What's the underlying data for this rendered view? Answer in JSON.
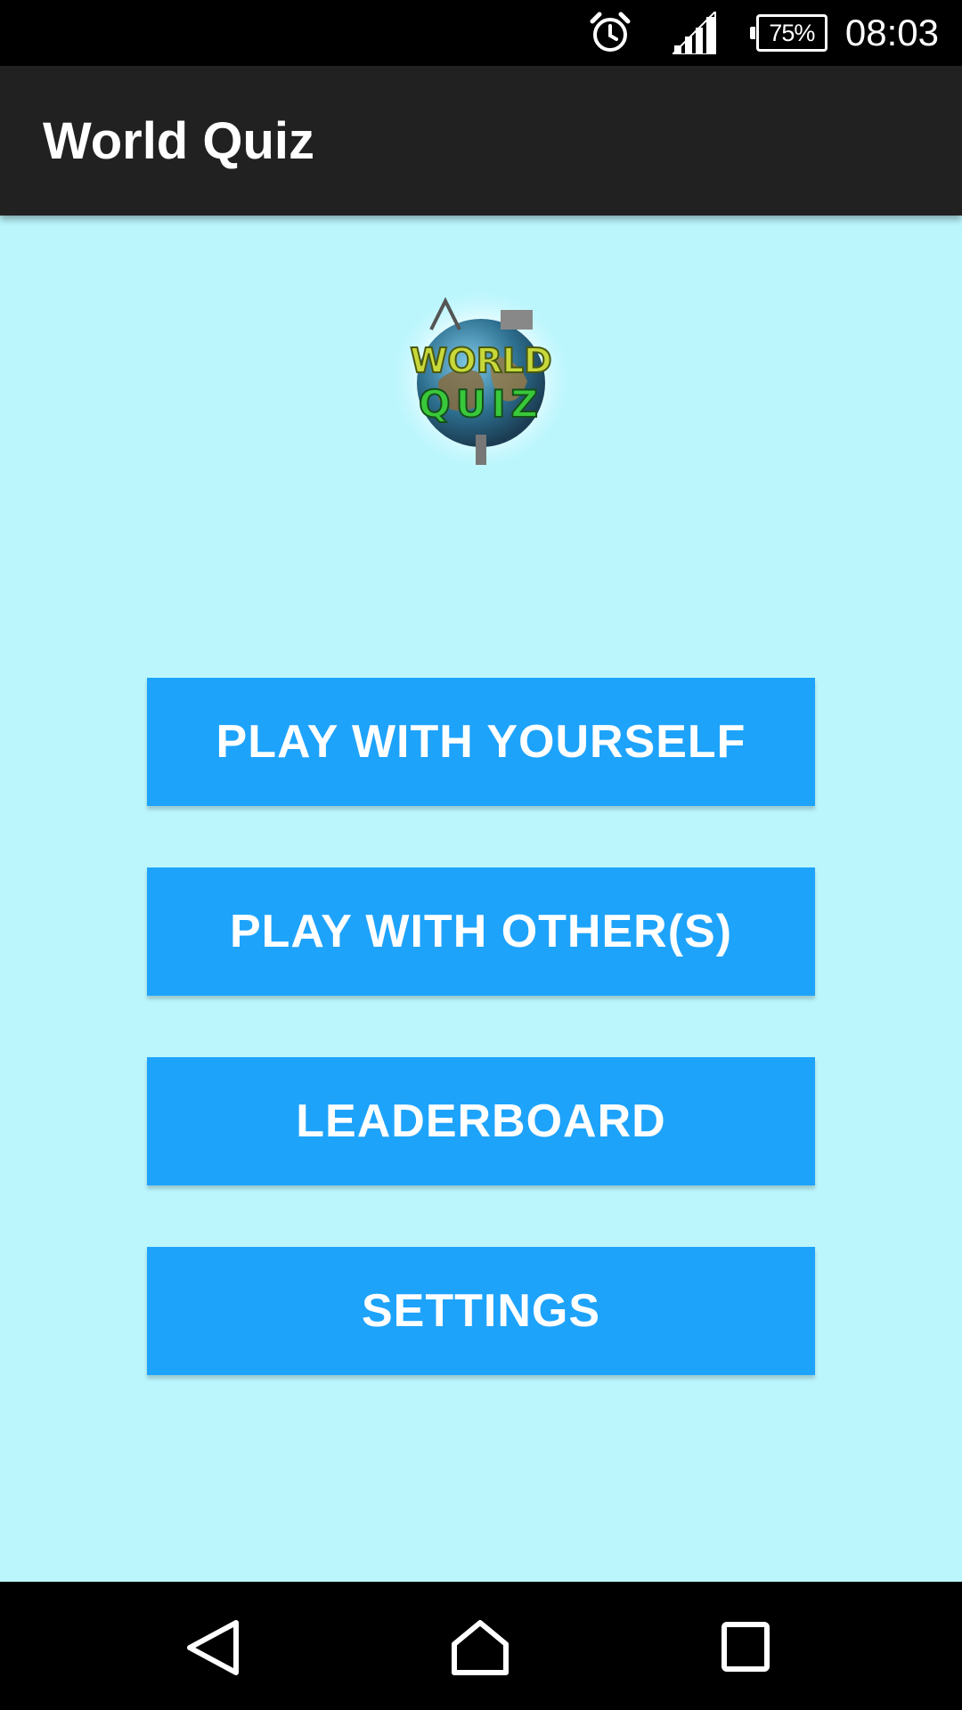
{
  "status_bar": {
    "battery": "75%",
    "time": "08:03",
    "icons": [
      "alarm-icon",
      "signal-icon",
      "battery-icon"
    ]
  },
  "app_bar": {
    "title": "World Quiz"
  },
  "logo": {
    "line1": "WORLD",
    "line2": "QUIZ"
  },
  "menu": {
    "buttons": [
      {
        "label": "PLAY WITH YOURSELF"
      },
      {
        "label": "PLAY WITH OTHER(S)"
      },
      {
        "label": "LEADERBOARD"
      },
      {
        "label": "SETTINGS"
      }
    ]
  },
  "nav_bar": {
    "icons": [
      "back-icon",
      "home-icon",
      "recent-apps-icon"
    ]
  },
  "colors": {
    "background": "#bbf6fd",
    "app_bar": "#212121",
    "button": "#1ea3fb",
    "button_text": "#ffffff",
    "system_bars": "#000000"
  }
}
